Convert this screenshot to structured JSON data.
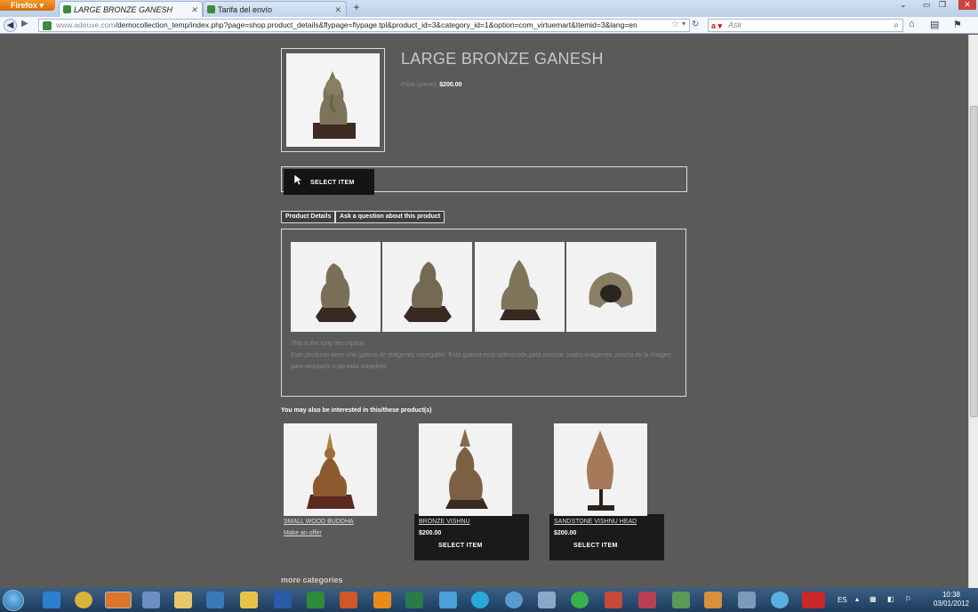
{
  "browser": {
    "menu_label": "Firefox",
    "tabs": [
      {
        "label": "LARGE BRONZE GANESH"
      },
      {
        "label": "Tarifa del envío"
      }
    ],
    "url_host": "www.adeuve.com",
    "url_path": "/democollection_temp/index.php?page=shop.product_details&flypage=flypage.tpl&product_id=3&category_id=1&option=com_virtuemart&Itemid=3&lang=en",
    "search_placeholder": "Ask",
    "search_brand": "Ask"
  },
  "product": {
    "title": "LARGE BRONZE GANESH",
    "price_label": "Price (piece):",
    "price_value": "$200.00",
    "select_label": "SELECT ITEM"
  },
  "tabs": [
    {
      "label": "Product Details"
    },
    {
      "label": "Ask a question about this product"
    }
  ],
  "description": {
    "line1": "This is the long description",
    "line2": "Este producto tiene una galería de imágenes navegable. Esta galería está optimizada para mostrar cuatro imágenes, pincha en la imagen",
    "line3": "para ampliarla a pantalla completa"
  },
  "related": {
    "heading": "You may also be interested in this/these product(s)",
    "items": [
      {
        "name": "SMALL WOOD BUDDHA",
        "action": "Make an offer"
      },
      {
        "name": "BRONZE VISHNU",
        "price": "$200.00",
        "select": "SELECT ITEM"
      },
      {
        "name": "SANDSTONE VISHNU HEAD",
        "price": "$200.00",
        "select": "SELECT ITEM"
      }
    ]
  },
  "more_categories": "more categories",
  "taskbar": {
    "language": "ES",
    "time": "10:38",
    "date": "03/01/2012"
  },
  "colors": {
    "page_bg": "#5a5a5a",
    "button_dark": "#141414",
    "border_light": "#dddddd"
  }
}
